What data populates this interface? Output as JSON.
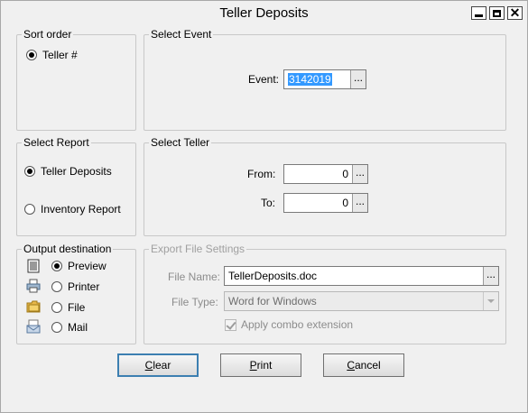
{
  "window": {
    "title": "Teller Deposits"
  },
  "sort_order": {
    "legend": "Sort order",
    "options": [
      {
        "label": "Teller #",
        "selected": true
      }
    ]
  },
  "select_event": {
    "legend": "Select Event",
    "event_label": "Event:",
    "event_value": "3142019",
    "browse": "..."
  },
  "select_report": {
    "legend": "Select Report",
    "options": [
      {
        "label": "Teller Deposits",
        "selected": true
      },
      {
        "label": "Inventory Report",
        "selected": false
      }
    ]
  },
  "select_teller": {
    "legend": "Select Teller",
    "from_label": "From:",
    "from_value": "0",
    "to_label": "To:",
    "to_value": "0",
    "browse": "..."
  },
  "output_destination": {
    "legend": "Output destination",
    "options": [
      {
        "label": "Preview",
        "icon": "preview-icon",
        "selected": true
      },
      {
        "label": "Printer",
        "icon": "printer-icon",
        "selected": false
      },
      {
        "label": "File",
        "icon": "folder-icon",
        "selected": false
      },
      {
        "label": "Mail",
        "icon": "mail-icon",
        "selected": false
      }
    ]
  },
  "export_settings": {
    "legend": "Export  File Settings",
    "file_name_label": "File Name:",
    "file_name_value": "TellerDeposits.doc",
    "file_type_label": "File Type:",
    "file_type_value": "Word for Windows",
    "apply_combo_label": "Apply combo extension",
    "apply_combo_checked": true,
    "browse": "..."
  },
  "buttons": {
    "clear_prefix": "",
    "clear_hot": "C",
    "clear_rest": "lear",
    "print_prefix": "",
    "print_hot": "P",
    "print_rest": "rint",
    "cancel_prefix": "",
    "cancel_hot": "C",
    "cancel_rest": "ancel"
  },
  "colors": {
    "selection": "#3399ff",
    "default_button_border": "#3c7fb1",
    "disabled_text": "#8c8c8c"
  }
}
